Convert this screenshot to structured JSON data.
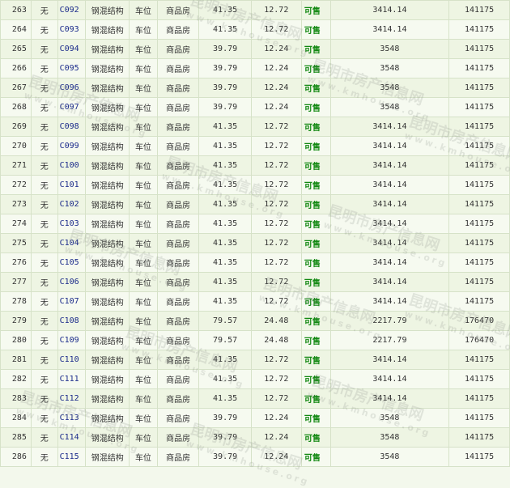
{
  "table": {
    "rows": [
      {
        "num": "263",
        "col2": "无",
        "code": "C092",
        "structure": "钢混结构",
        "usage": "车位",
        "nature": "商品房",
        "area": "41.35",
        "inner_area": "12.72",
        "status": "可售",
        "unit_price": "3414.14",
        "total": "141175"
      },
      {
        "num": "264",
        "col2": "无",
        "code": "C093",
        "structure": "钢混结构",
        "usage": "车位",
        "nature": "商品房",
        "area": "41.35",
        "inner_area": "12.72",
        "status": "可售",
        "unit_price": "3414.14",
        "total": "141175"
      },
      {
        "num": "265",
        "col2": "无",
        "code": "C094",
        "structure": "钢混结构",
        "usage": "车位",
        "nature": "商品房",
        "area": "39.79",
        "inner_area": "12.24",
        "status": "可售",
        "unit_price": "3548",
        "total": "141175"
      },
      {
        "num": "266",
        "col2": "无",
        "code": "C095",
        "structure": "钢混结构",
        "usage": "车位",
        "nature": "商品房",
        "area": "39.79",
        "inner_area": "12.24",
        "status": "可售",
        "unit_price": "3548",
        "total": "141175"
      },
      {
        "num": "267",
        "col2": "无",
        "code": "C096",
        "structure": "钢混结构",
        "usage": "车位",
        "nature": "商品房",
        "area": "39.79",
        "inner_area": "12.24",
        "status": "可售",
        "unit_price": "3548",
        "total": "141175"
      },
      {
        "num": "268",
        "col2": "无",
        "code": "C097",
        "structure": "钢混结构",
        "usage": "车位",
        "nature": "商品房",
        "area": "39.79",
        "inner_area": "12.24",
        "status": "可售",
        "unit_price": "3548",
        "total": "141175"
      },
      {
        "num": "269",
        "col2": "无",
        "code": "C098",
        "structure": "钢混结构",
        "usage": "车位",
        "nature": "商品房",
        "area": "41.35",
        "inner_area": "12.72",
        "status": "可售",
        "unit_price": "3414.14",
        "total": "141175"
      },
      {
        "num": "270",
        "col2": "无",
        "code": "C099",
        "structure": "钢混结构",
        "usage": "车位",
        "nature": "商品房",
        "area": "41.35",
        "inner_area": "12.72",
        "status": "可售",
        "unit_price": "3414.14",
        "total": "141175"
      },
      {
        "num": "271",
        "col2": "无",
        "code": "C100",
        "structure": "钢混结构",
        "usage": "车位",
        "nature": "商品房",
        "area": "41.35",
        "inner_area": "12.72",
        "status": "可售",
        "unit_price": "3414.14",
        "total": "141175"
      },
      {
        "num": "272",
        "col2": "无",
        "code": "C101",
        "structure": "钢混结构",
        "usage": "车位",
        "nature": "商品房",
        "area": "41.35",
        "inner_area": "12.72",
        "status": "可售",
        "unit_price": "3414.14",
        "total": "141175"
      },
      {
        "num": "273",
        "col2": "无",
        "code": "C102",
        "structure": "钢混结构",
        "usage": "车位",
        "nature": "商品房",
        "area": "41.35",
        "inner_area": "12.72",
        "status": "可售",
        "unit_price": "3414.14",
        "total": "141175"
      },
      {
        "num": "274",
        "col2": "无",
        "code": "C103",
        "structure": "钢混结构",
        "usage": "车位",
        "nature": "商品房",
        "area": "41.35",
        "inner_area": "12.72",
        "status": "可售",
        "unit_price": "3414.14",
        "total": "141175"
      },
      {
        "num": "275",
        "col2": "无",
        "code": "C104",
        "structure": "钢混结构",
        "usage": "车位",
        "nature": "商品房",
        "area": "41.35",
        "inner_area": "12.72",
        "status": "可售",
        "unit_price": "3414.14",
        "total": "141175"
      },
      {
        "num": "276",
        "col2": "无",
        "code": "C105",
        "structure": "钢混结构",
        "usage": "车位",
        "nature": "商品房",
        "area": "41.35",
        "inner_area": "12.72",
        "status": "可售",
        "unit_price": "3414.14",
        "total": "141175"
      },
      {
        "num": "277",
        "col2": "无",
        "code": "C106",
        "structure": "钢混结构",
        "usage": "车位",
        "nature": "商品房",
        "area": "41.35",
        "inner_area": "12.72",
        "status": "可售",
        "unit_price": "3414.14",
        "total": "141175"
      },
      {
        "num": "278",
        "col2": "无",
        "code": "C107",
        "structure": "钢混结构",
        "usage": "车位",
        "nature": "商品房",
        "area": "41.35",
        "inner_area": "12.72",
        "status": "可售",
        "unit_price": "3414.14",
        "total": "141175"
      },
      {
        "num": "279",
        "col2": "无",
        "code": "C108",
        "structure": "钢混结构",
        "usage": "车位",
        "nature": "商品房",
        "area": "79.57",
        "inner_area": "24.48",
        "status": "可售",
        "unit_price": "2217.79",
        "total": "176470"
      },
      {
        "num": "280",
        "col2": "无",
        "code": "C109",
        "structure": "钢混结构",
        "usage": "车位",
        "nature": "商品房",
        "area": "79.57",
        "inner_area": "24.48",
        "status": "可售",
        "unit_price": "2217.79",
        "total": "176470"
      },
      {
        "num": "281",
        "col2": "无",
        "code": "C110",
        "structure": "钢混结构",
        "usage": "车位",
        "nature": "商品房",
        "area": "41.35",
        "inner_area": "12.72",
        "status": "可售",
        "unit_price": "3414.14",
        "total": "141175"
      },
      {
        "num": "282",
        "col2": "无",
        "code": "C111",
        "structure": "钢混结构",
        "usage": "车位",
        "nature": "商品房",
        "area": "41.35",
        "inner_area": "12.72",
        "status": "可售",
        "unit_price": "3414.14",
        "total": "141175"
      },
      {
        "num": "283",
        "col2": "无",
        "code": "C112",
        "structure": "钢混结构",
        "usage": "车位",
        "nature": "商品房",
        "area": "41.35",
        "inner_area": "12.72",
        "status": "可售",
        "unit_price": "3414.14",
        "total": "141175"
      },
      {
        "num": "284",
        "col2": "无",
        "code": "C113",
        "structure": "钢混结构",
        "usage": "车位",
        "nature": "商品房",
        "area": "39.79",
        "inner_area": "12.24",
        "status": "可售",
        "unit_price": "3548",
        "total": "141175"
      },
      {
        "num": "285",
        "col2": "无",
        "code": "C114",
        "structure": "钢混结构",
        "usage": "车位",
        "nature": "商品房",
        "area": "39.79",
        "inner_area": "12.24",
        "status": "可售",
        "unit_price": "3548",
        "total": "141175"
      },
      {
        "num": "286",
        "col2": "无",
        "code": "C115",
        "structure": "钢混结构",
        "usage": "车位",
        "nature": "商品房",
        "area": "39.79",
        "inner_area": "12.24",
        "status": "可售",
        "unit_price": "3548",
        "total": "141175"
      }
    ]
  },
  "watermark": {
    "text": "昆明市房产信息网",
    "domain": "www.kmhouse.org"
  },
  "colors": {
    "status_available": "#118811",
    "code_link": "#1a2a8a",
    "row_bg": "#eef5e3",
    "border": "#d6e2c8"
  }
}
